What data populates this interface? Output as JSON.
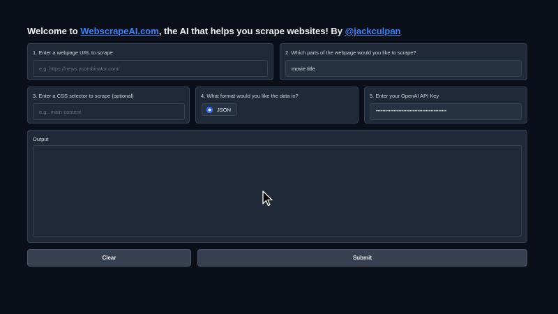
{
  "header": {
    "prefix": "Welcome to ",
    "site_link": "WebscrapeAI.com",
    "middle": ", the AI that helps you scrape websites! By ",
    "author_link": "@jackculpan"
  },
  "fields": {
    "url": {
      "label": "1. Enter a webpage URL to scrape",
      "placeholder": "e.g. https://news.ycombinator.com/",
      "value": ""
    },
    "parts": {
      "label": "2. Which parts of the webpage would you like to scrape?",
      "value": "movie title"
    },
    "css": {
      "label": "3. Enter a CSS selector to scrape (optional)",
      "placeholder": "e.g. .main-content",
      "value": ""
    },
    "format": {
      "label": "4. What format would you like the data in?",
      "selected": "JSON"
    },
    "api_key": {
      "label": "5. Enter your OpenAI API Key",
      "value": "••••••••••••••••••••••••••••••••••••••••••••"
    }
  },
  "output": {
    "label": "Output"
  },
  "buttons": {
    "clear": "Clear",
    "submit": "Submit"
  },
  "colors": {
    "background": "#0b0f19",
    "card": "#1f2937",
    "link": "#3b82f6",
    "radio_accent": "#2563eb"
  },
  "icons": {
    "cursor": "mouse-pointer-icon"
  }
}
